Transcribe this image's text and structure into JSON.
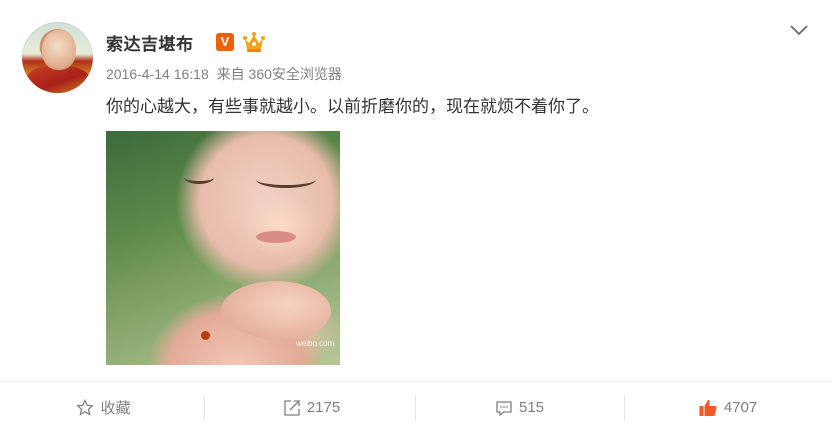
{
  "post": {
    "username": "索达吉堪布",
    "verified_badge": "V",
    "timestamp": "2016-4-14 16:18",
    "source": "来自 360安全浏览器",
    "text": "你的心越大，有些事就越小。以前折磨你的，现在就烦不着你了。",
    "image_watermark": "weibo.com"
  },
  "actions": {
    "favorite_label": "收藏",
    "repost_count": "2175",
    "comment_count": "515",
    "like_count": "4707"
  },
  "colors": {
    "badge": "#f06000",
    "like_icon": "#f05a28",
    "muted_text": "#808080"
  }
}
